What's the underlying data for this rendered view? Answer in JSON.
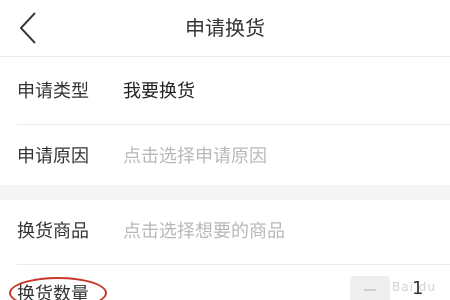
{
  "header": {
    "title": "申请换货",
    "back_icon": "chevron-left-icon"
  },
  "form": {
    "type": {
      "label": "申请类型",
      "value": "我要换货"
    },
    "reason": {
      "label": "申请原因",
      "placeholder": "点击选择申请原因"
    },
    "product": {
      "label": "换货商品",
      "placeholder": "点击选择想要的商品"
    },
    "quantity": {
      "label": "换货数量",
      "value": "1",
      "highlight_color": "#c8362c"
    }
  },
  "watermark": "Bai du"
}
